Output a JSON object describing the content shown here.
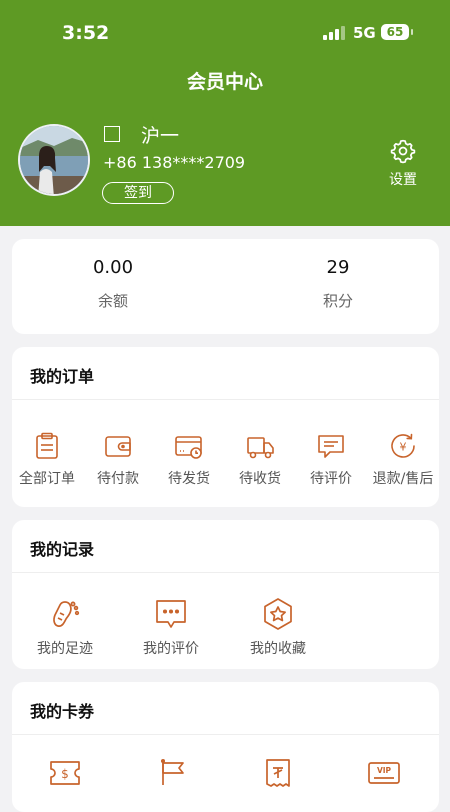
{
  "status_bar": {
    "time": "3:52",
    "network": "5G",
    "battery": "65"
  },
  "header": {
    "title": "会员中心"
  },
  "profile": {
    "name": "沪一",
    "phone": "+86 138****2709",
    "checkin_label": "签到",
    "settings_label": "设置"
  },
  "stats": [
    {
      "value": "0.00",
      "label": "余额"
    },
    {
      "value": "29",
      "label": "积分"
    }
  ],
  "orders": {
    "title": "我的订单",
    "items": [
      {
        "label": "全部订单",
        "icon": "order-list-icon"
      },
      {
        "label": "待付款",
        "icon": "wallet-icon"
      },
      {
        "label": "待发货",
        "icon": "card-clock-icon"
      },
      {
        "label": "待收货",
        "icon": "truck-icon"
      },
      {
        "label": "待评价",
        "icon": "comment-icon"
      },
      {
        "label": "退款/售后",
        "icon": "refund-icon"
      }
    ]
  },
  "records": {
    "title": "我的记录",
    "items": [
      {
        "label": "我的足迹",
        "icon": "footprint-icon"
      },
      {
        "label": "我的评价",
        "icon": "review-icon"
      },
      {
        "label": "我的收藏",
        "icon": "star-badge-icon"
      }
    ]
  },
  "coupons": {
    "title": "我的卡券",
    "items": [
      {
        "icon": "dollar-ticket-icon"
      },
      {
        "icon": "flag-icon"
      },
      {
        "icon": "voucher-icon"
      },
      {
        "icon": "vip-card-icon"
      }
    ]
  },
  "colors": {
    "header": "#5e9a24",
    "icon_accent": "#c8642c",
    "background": "#f2f2f4"
  }
}
